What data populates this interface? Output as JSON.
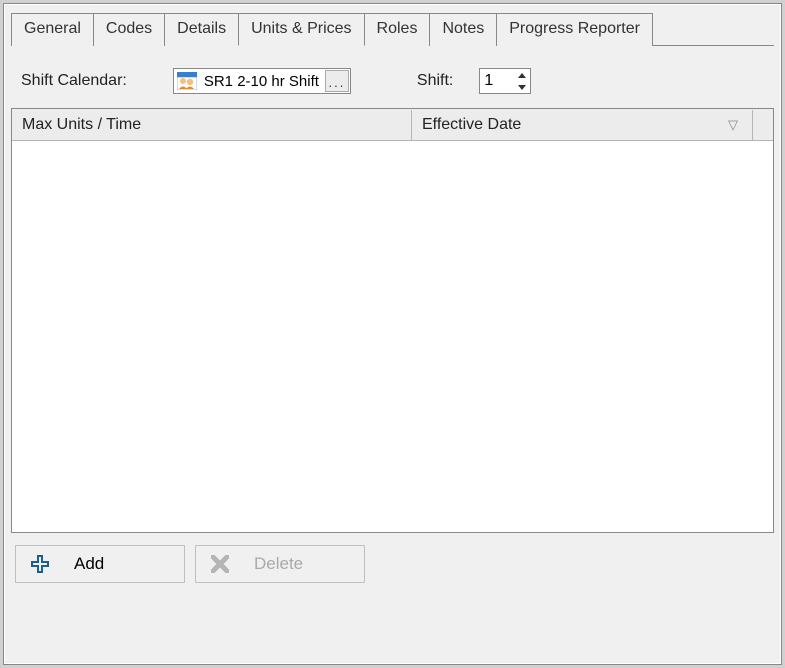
{
  "tabs": {
    "general": "General",
    "codes": "Codes",
    "details": "Details",
    "units_prices": "Units & Prices",
    "roles": "Roles",
    "notes": "Notes",
    "progress_reporter": "Progress Reporter"
  },
  "calendar": {
    "label": "Shift Calendar:",
    "value": "SR1 2-10 hr Shift",
    "browse": "..."
  },
  "shift": {
    "label": "Shift:",
    "value": "1"
  },
  "table": {
    "col1": "Max Units / Time",
    "col2": "Effective Date"
  },
  "buttons": {
    "add": "Add",
    "delete": "Delete"
  }
}
